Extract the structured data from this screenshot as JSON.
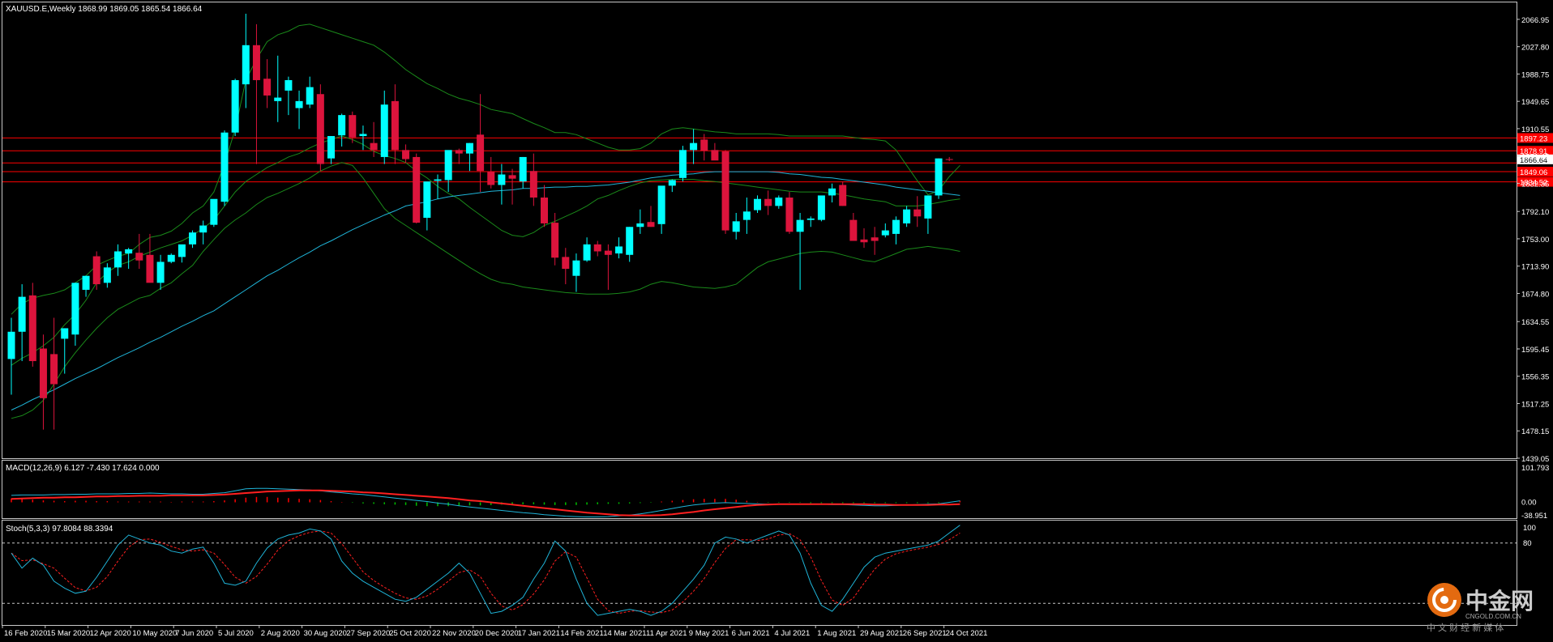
{
  "main_panel": {
    "header": "XAUUSD.E,Weekly  1868.99 1869.05 1865.54 1866.64",
    "price_ticks": [
      "2066.95",
      "2027.80",
      "1988.75",
      "1949.65",
      "1910.55",
      "1871.45",
      "1832.35",
      "1792.10",
      "1753.00",
      "1713.90",
      "1674.80",
      "1634.55",
      "1595.45",
      "1556.35",
      "1517.25",
      "1478.15",
      "1439.05"
    ],
    "price_range": [
      1439.05,
      2090
    ],
    "current_price_label": "1866.64",
    "current_price": 1866.64,
    "horizontal_levels": [
      {
        "price": 1897.23,
        "label": "1897.23"
      },
      {
        "price": 1878.91,
        "label": "1878.91"
      },
      {
        "price": 1861.5,
        "label": ""
      },
      {
        "price": 1849.06,
        "label": "1849.06"
      },
      {
        "price": 1834.52,
        "label": "1834.52"
      }
    ]
  },
  "macd_panel": {
    "header": "MACD(12,26,9) 6.127 -7.430 17.624 0.000",
    "ticks": [
      "101.793",
      "0.00",
      "-38.951"
    ]
  },
  "stoch_panel": {
    "header": "Stoch(5,3,3) 97.8084 88.3394",
    "ticks": [
      "100",
      "80"
    ],
    "levels": [
      80,
      20
    ]
  },
  "x_labels": [
    "16 Feb 2020",
    "15 Mar 2020",
    "12 Apr 2020",
    "10 May 2020",
    "7 Jun 2020",
    "5 Jul 2020",
    "2 Aug 2020",
    "30 Aug 2020",
    "27 Sep 2020",
    "25 Oct 2020",
    "22 Nov 2020",
    "20 Dec 2020",
    "17 Jan 2021",
    "14 Feb 2021",
    "14 Mar 2021",
    "11 Apr 2021",
    "9 May 2021",
    "6 Jun 2021",
    "4 Jul 2021",
    "1 Aug 2021",
    "29 Aug 2021",
    "26 Sep 2021",
    "24 Oct 2021"
  ],
  "watermark": {
    "brand": "中金网",
    "site": "CNGOLD.COM.CN",
    "tagline": "中 文 财 经 新 媒 体"
  },
  "colors": {
    "bull": "#00ffff",
    "bear": "#dc143c",
    "band": "#1a8a1a",
    "ma": "#1fb4d8",
    "level": "#ff0000",
    "grid": "#ffffff",
    "macd_pos": "#ff0000",
    "macd_neg": "#00c000"
  },
  "chart_data": {
    "type": "candlestick",
    "symbol": "XAUUSD.E",
    "timeframe": "Weekly",
    "candles": [
      [
        1581,
        1640,
        1530,
        1620
      ],
      [
        1620,
        1688,
        1578,
        1670
      ],
      [
        1672,
        1690,
        1570,
        1578
      ],
      [
        1596,
        1616,
        1480,
        1525
      ],
      [
        1588,
        1640,
        1480,
        1545
      ],
      [
        1610,
        1625,
        1560,
        1625
      ],
      [
        1616,
        1690,
        1600,
        1690
      ],
      [
        1680,
        1700,
        1670,
        1700
      ],
      [
        1728,
        1735,
        1680,
        1688
      ],
      [
        1690,
        1718,
        1683,
        1712
      ],
      [
        1712,
        1745,
        1700,
        1735
      ],
      [
        1732,
        1740,
        1710,
        1738
      ],
      [
        1733,
        1760,
        1710,
        1722
      ],
      [
        1730,
        1760,
        1700,
        1690
      ],
      [
        1690,
        1730,
        1680,
        1720
      ],
      [
        1720,
        1732,
        1718,
        1730
      ],
      [
        1727,
        1740,
        1719,
        1745
      ],
      [
        1745,
        1765,
        1740,
        1762
      ],
      [
        1762,
        1779,
        1745,
        1772
      ],
      [
        1773,
        1800,
        1770,
        1810
      ],
      [
        1806,
        1908,
        1800,
        1905
      ],
      [
        1905,
        1982,
        1900,
        1980
      ],
      [
        1974,
        2075,
        1940,
        2030
      ],
      [
        2030,
        2060,
        1860,
        1980
      ],
      [
        1982,
        2010,
        1940,
        1958
      ],
      [
        1950,
        2015,
        1920,
        1955
      ],
      [
        1965,
        1985,
        1930,
        1980
      ],
      [
        1940,
        1965,
        1910,
        1950
      ],
      [
        1945,
        1985,
        1940,
        1970
      ],
      [
        1960,
        1974,
        1850,
        1860
      ],
      [
        1868,
        1900,
        1860,
        1900
      ],
      [
        1901,
        1932,
        1885,
        1930
      ],
      [
        1930,
        1935,
        1890,
        1898
      ],
      [
        1900,
        1915,
        1880,
        1903
      ],
      [
        1890,
        1920,
        1870,
        1880
      ],
      [
        1870,
        1965,
        1860,
        1945
      ],
      [
        1950,
        1974,
        1860,
        1880
      ],
      [
        1880,
        1888,
        1862,
        1867
      ],
      [
        1870,
        1875,
        1775,
        1776
      ],
      [
        1783,
        1820,
        1765,
        1835
      ],
      [
        1836,
        1845,
        1810,
        1838
      ],
      [
        1837,
        1875,
        1820,
        1880
      ],
      [
        1880,
        1882,
        1860,
        1875
      ],
      [
        1875,
        1890,
        1850,
        1890
      ],
      [
        1902,
        1960,
        1820,
        1850
      ],
      [
        1849,
        1870,
        1825,
        1830
      ],
      [
        1830,
        1860,
        1802,
        1845
      ],
      [
        1844,
        1853,
        1802,
        1839
      ],
      [
        1835,
        1870,
        1825,
        1870
      ],
      [
        1850,
        1875,
        1800,
        1812
      ],
      [
        1812,
        1830,
        1770,
        1775
      ],
      [
        1776,
        1790,
        1715,
        1726
      ],
      [
        1727,
        1740,
        1688,
        1710
      ],
      [
        1700,
        1732,
        1677,
        1722
      ],
      [
        1722,
        1755,
        1720,
        1745
      ],
      [
        1745,
        1750,
        1728,
        1735
      ],
      [
        1736,
        1745,
        1680,
        1730
      ],
      [
        1732,
        1755,
        1725,
        1742
      ],
      [
        1730,
        1770,
        1720,
        1770
      ],
      [
        1770,
        1795,
        1760,
        1775
      ],
      [
        1777,
        1800,
        1770,
        1770
      ],
      [
        1774,
        1802,
        1760,
        1829
      ],
      [
        1829,
        1838,
        1820,
        1837
      ],
      [
        1840,
        1886,
        1835,
        1880
      ],
      [
        1880,
        1910,
        1860,
        1890
      ],
      [
        1895,
        1903,
        1865,
        1879
      ],
      [
        1880,
        1890,
        1870,
        1865
      ],
      [
        1878,
        1880,
        1760,
        1765
      ],
      [
        1763,
        1790,
        1752,
        1778
      ],
      [
        1780,
        1812,
        1760,
        1792
      ],
      [
        1794,
        1815,
        1790,
        1810
      ],
      [
        1810,
        1822,
        1787,
        1800
      ],
      [
        1800,
        1815,
        1796,
        1812
      ],
      [
        1812,
        1820,
        1760,
        1763
      ],
      [
        1763,
        1790,
        1680,
        1780
      ],
      [
        1780,
        1785,
        1770,
        1782
      ],
      [
        1780,
        1810,
        1778,
        1815
      ],
      [
        1815,
        1832,
        1805,
        1825
      ],
      [
        1830,
        1835,
        1800,
        1800
      ],
      [
        1780,
        1790,
        1750,
        1750
      ],
      [
        1752,
        1768,
        1740,
        1748
      ],
      [
        1755,
        1770,
        1730,
        1750
      ],
      [
        1758,
        1775,
        1755,
        1765
      ],
      [
        1760,
        1785,
        1745,
        1780
      ],
      [
        1775,
        1800,
        1770,
        1795
      ],
      [
        1795,
        1814,
        1770,
        1785
      ],
      [
        1782,
        1813,
        1760,
        1815
      ],
      [
        1815,
        1868,
        1810,
        1868
      ],
      [
        1867,
        1870,
        1864,
        1866.64
      ]
    ],
    "ma_line": [
      1508,
      1515,
      1523,
      1530,
      1537,
      1545,
      1553,
      1560,
      1567,
      1575,
      1583,
      1590,
      1597,
      1605,
      1612,
      1620,
      1628,
      1635,
      1643,
      1650,
      1660,
      1670,
      1680,
      1690,
      1700,
      1708,
      1717,
      1726,
      1734,
      1743,
      1750,
      1758,
      1766,
      1773,
      1780,
      1787,
      1793,
      1800,
      1803,
      1806,
      1810,
      1813,
      1815,
      1817,
      1819,
      1821,
      1822,
      1823,
      1825,
      1825,
      1826,
      1827,
      1827,
      1828,
      1828,
      1829,
      1830,
      1832,
      1834,
      1837,
      1840,
      1842,
      1844,
      1845,
      1846,
      1848,
      1849,
      1849,
      1849,
      1849,
      1849,
      1849,
      1848,
      1846,
      1845,
      1843,
      1841,
      1840,
      1838,
      1836,
      1834,
      1832,
      1830,
      1827,
      1825,
      1823,
      1821,
      1819,
      1817,
      1815
    ],
    "bb_upper": [
      1645,
      1660,
      1668,
      1672,
      1675,
      1680,
      1690,
      1700,
      1715,
      1722,
      1728,
      1732,
      1745,
      1755,
      1758,
      1764,
      1775,
      1790,
      1800,
      1820,
      1860,
      1910,
      1980,
      2010,
      2035,
      2045,
      2050,
      2058,
      2060,
      2055,
      2050,
      2045,
      2040,
      2035,
      2030,
      2020,
      2008,
      1995,
      1985,
      1975,
      1968,
      1960,
      1954,
      1950,
      1945,
      1938,
      1935,
      1932,
      1925,
      1918,
      1912,
      1905,
      1905,
      1902,
      1896,
      1890,
      1884,
      1880,
      1880,
      1882,
      1890,
      1903,
      1910,
      1912,
      1910,
      1908,
      1906,
      1905,
      1903,
      1903,
      1903,
      1903,
      1902,
      1900,
      1900,
      1900,
      1900,
      1900,
      1900,
      1898,
      1896,
      1895,
      1893,
      1880,
      1858,
      1836,
      1816,
      1822,
      1842,
      1858
    ],
    "bb_middle": [
      1572,
      1582,
      1590,
      1600,
      1612,
      1630,
      1645,
      1665,
      1690,
      1705,
      1715,
      1720,
      1728,
      1734,
      1740,
      1745,
      1750,
      1758,
      1768,
      1780,
      1800,
      1820,
      1835,
      1845,
      1855,
      1862,
      1870,
      1875,
      1883,
      1890,
      1895,
      1900,
      1895,
      1888,
      1878,
      1872,
      1868,
      1862,
      1850,
      1840,
      1828,
      1818,
      1810,
      1798,
      1787,
      1776,
      1765,
      1758,
      1756,
      1762,
      1772,
      1778,
      1785,
      1792,
      1800,
      1810,
      1815,
      1822,
      1828,
      1833,
      1836,
      1837,
      1838,
      1838,
      1838,
      1836,
      1835,
      1833,
      1831,
      1829,
      1827,
      1825,
      1823,
      1821,
      1820,
      1820,
      1820,
      1818,
      1816,
      1813,
      1810,
      1808,
      1806,
      1800,
      1800,
      1800,
      1802,
      1805,
      1808,
      1810
    ],
    "bb_lower": [
      1496,
      1500,
      1508,
      1522,
      1545,
      1570,
      1590,
      1608,
      1625,
      1640,
      1652,
      1660,
      1668,
      1672,
      1682,
      1690,
      1703,
      1715,
      1735,
      1752,
      1768,
      1780,
      1790,
      1802,
      1812,
      1818,
      1825,
      1832,
      1840,
      1850,
      1857,
      1862,
      1858,
      1840,
      1818,
      1796,
      1782,
      1772,
      1762,
      1752,
      1742,
      1732,
      1722,
      1712,
      1703,
      1695,
      1690,
      1688,
      1684,
      1682,
      1680,
      1678,
      1676,
      1675,
      1674,
      1674,
      1674,
      1675,
      1677,
      1681,
      1688,
      1692,
      1690,
      1687,
      1684,
      1683,
      1682,
      1684,
      1688,
      1700,
      1712,
      1720,
      1724,
      1728,
      1732,
      1734,
      1735,
      1734,
      1730,
      1726,
      1722,
      1720,
      1726,
      1732,
      1738,
      1740,
      1742,
      1740,
      1738,
      1735
    ],
    "macd_hist": [
      10,
      9,
      7,
      5,
      4,
      3,
      4,
      4,
      3,
      3,
      2,
      2,
      2,
      2,
      2,
      1,
      2,
      2,
      2,
      3,
      5,
      8,
      12,
      14,
      14,
      12,
      11,
      9,
      8,
      6,
      3,
      1,
      -1,
      -3,
      -4,
      -5,
      -6,
      -7,
      -9,
      -10,
      -10,
      -10,
      -9,
      -8,
      -8,
      -7,
      -6,
      -6,
      -5,
      -5,
      -6,
      -7,
      -7,
      -7,
      -6,
      -5,
      -4,
      -4,
      -3,
      -2,
      -1,
      2,
      4,
      6,
      8,
      9,
      9,
      9,
      7,
      4,
      1,
      -1,
      -1,
      -1,
      -1,
      -2,
      -2,
      -2,
      -2,
      -2,
      -2,
      -2,
      -2,
      -2,
      -2,
      -2,
      -2,
      -2,
      1,
      4
    ],
    "macd_main": [
      18,
      19,
      19,
      19,
      20,
      20,
      21,
      21,
      22,
      22,
      22,
      23,
      23,
      24,
      23,
      22,
      22,
      21,
      21,
      23,
      25,
      30,
      35,
      36,
      36,
      35,
      34,
      33,
      32,
      30,
      27,
      25,
      22,
      20,
      17,
      14,
      11,
      8,
      5,
      2,
      -2,
      -5,
      -9,
      -12,
      -15,
      -18,
      -21,
      -24,
      -27,
      -29,
      -32,
      -34,
      -36,
      -37,
      -38,
      -38,
      -37,
      -35,
      -33,
      -30,
      -26,
      -21,
      -16,
      -11,
      -7,
      -4,
      -2,
      -1,
      -2,
      -3,
      -4,
      -5,
      -5,
      -5,
      -5,
      -5,
      -5,
      -6,
      -6,
      -7,
      -8,
      -9,
      -9,
      -8,
      -7,
      -6,
      -5,
      -4,
      0,
      4
    ],
    "macd_signal": [
      9,
      10,
      11,
      12,
      12,
      13,
      13,
      14,
      15,
      15,
      16,
      16,
      17,
      17,
      17,
      18,
      18,
      18,
      18,
      19,
      20,
      22,
      24,
      26,
      28,
      29,
      30,
      31,
      31,
      31,
      30,
      29,
      28,
      26,
      25,
      23,
      21,
      19,
      17,
      15,
      13,
      11,
      8,
      5,
      3,
      0,
      -3,
      -6,
      -9,
      -12,
      -15,
      -18,
      -21,
      -24,
      -27,
      -29,
      -31,
      -33,
      -34,
      -34,
      -34,
      -33,
      -31,
      -28,
      -25,
      -21,
      -18,
      -15,
      -12,
      -9,
      -7,
      -6,
      -5,
      -5,
      -5,
      -5,
      -5,
      -5,
      -5,
      -5,
      -5,
      -6,
      -6,
      -7,
      -7,
      -7,
      -7,
      -6,
      -6,
      -5
    ],
    "stoch_k": [
      70,
      55,
      65,
      58,
      42,
      35,
      30,
      32,
      46,
      62,
      78,
      88,
      84,
      80,
      78,
      72,
      70,
      74,
      76,
      60,
      40,
      38,
      42,
      60,
      75,
      84,
      88,
      90,
      94,
      92,
      84,
      62,
      50,
      42,
      36,
      30,
      24,
      22,
      26,
      34,
      42,
      50,
      60,
      50,
      30,
      10,
      12,
      18,
      26,
      44,
      60,
      82,
      72,
      44,
      20,
      8,
      10,
      12,
      14,
      12,
      8,
      12,
      20,
      32,
      44,
      58,
      80,
      86,
      84,
      80,
      84,
      88,
      92,
      88,
      70,
      40,
      18,
      12,
      24,
      40,
      56,
      66,
      70,
      72,
      74,
      76,
      78,
      82,
      90,
      97.8
    ]
  }
}
